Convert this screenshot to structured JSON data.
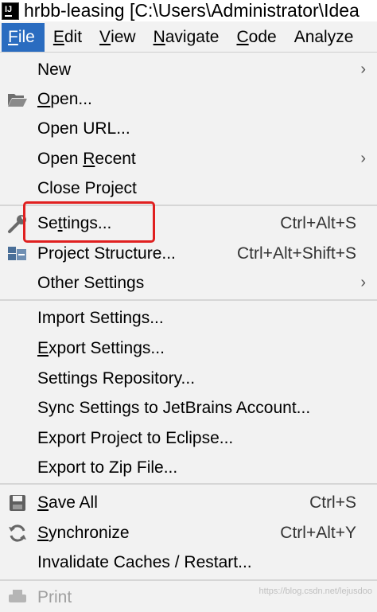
{
  "window": {
    "title": "hrbb-leasing [C:\\Users\\Administrator\\Idea"
  },
  "menubar": {
    "items": [
      {
        "label": "File",
        "mnemonic": "F",
        "rest": "ile"
      },
      {
        "label": "Edit",
        "mnemonic": "E",
        "rest": "dit"
      },
      {
        "label": "View",
        "mnemonic": "V",
        "rest": "iew"
      },
      {
        "label": "Navigate",
        "mnemonic": "N",
        "rest": "avigate"
      },
      {
        "label": "Code",
        "mnemonic": "C",
        "rest": "ode"
      },
      {
        "label": "Analyze",
        "mnemonic": "",
        "rest": "Analyze"
      }
    ]
  },
  "file_menu": {
    "items": {
      "new": {
        "label": "New"
      },
      "open": {
        "pre": "",
        "mnemonic": "O",
        "post": "pen..."
      },
      "open_url": {
        "label": "Open URL..."
      },
      "open_recent": {
        "pre": "Open ",
        "mnemonic": "R",
        "post": "ecent"
      },
      "close_project": {
        "pre": "Close Pro",
        "mnemonic": "j",
        "post": "ect"
      },
      "settings": {
        "pre": "Se",
        "mnemonic": "t",
        "post": "tings...",
        "shortcut": "Ctrl+Alt+S"
      },
      "project_structure": {
        "label": "Project Structure...",
        "shortcut": "Ctrl+Alt+Shift+S"
      },
      "other_settings": {
        "label": "Other Settings"
      },
      "import_settings": {
        "label": "Import Settings..."
      },
      "export_settings": {
        "pre": "",
        "mnemonic": "E",
        "post": "xport Settings..."
      },
      "settings_repository": {
        "label": "Settings Repository..."
      },
      "sync_settings": {
        "label": "Sync Settings to JetBrains Account..."
      },
      "export_eclipse": {
        "label": "Export Project to Eclipse..."
      },
      "export_zip": {
        "label": "Export to Zip File..."
      },
      "save_all": {
        "pre": "",
        "mnemonic": "S",
        "post": "ave All",
        "shortcut": "Ctrl+S"
      },
      "synchronize": {
        "pre": "",
        "mnemonic": "S",
        "post": "ynchronize",
        "shortcut": "Ctrl+Alt+Y"
      },
      "invalidate_caches": {
        "label": "Invalidate Caches / Restart..."
      },
      "print": {
        "label": "Print"
      }
    }
  },
  "watermark": "https://blog.csdn.net/lejusdoo",
  "colors": {
    "active_menu": "#2a6cc0",
    "highlight_box": "#e02020"
  }
}
